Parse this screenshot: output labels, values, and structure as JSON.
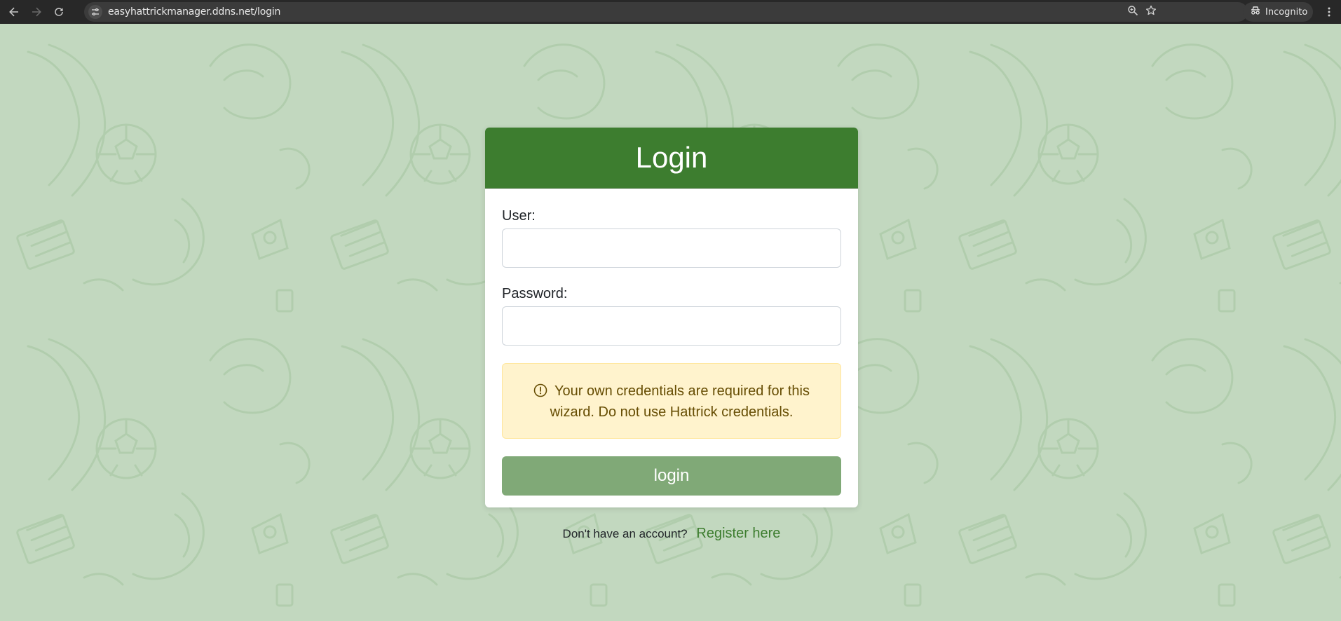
{
  "browser": {
    "url": "easyhattrickmanager.ddns.net/login",
    "incognito_label": "Incognito",
    "icons": [
      "back-icon",
      "forward-icon",
      "reload-icon",
      "site-info-icon",
      "zoom-icon",
      "bookmark-star-icon",
      "incognito-icon",
      "more-menu-icon"
    ]
  },
  "login": {
    "title": "Login",
    "user_label": "User:",
    "user_value": "",
    "password_label": "Password:",
    "password_value": "",
    "alert_text": "Your own credentials are required for this wizard. Do not use Hattrick credentials.",
    "alert_icon": "exclamation-circle-icon",
    "button_label": "login"
  },
  "register": {
    "prompt": "Don't have an account?",
    "link_label": "Register here"
  },
  "colors": {
    "header_green": "#3d7d2f",
    "button_green": "#80a977",
    "page_background": "#c2d8bf",
    "alert_background": "#fff3cd",
    "alert_text": "#664d03",
    "link_green": "#3d7d2f"
  }
}
